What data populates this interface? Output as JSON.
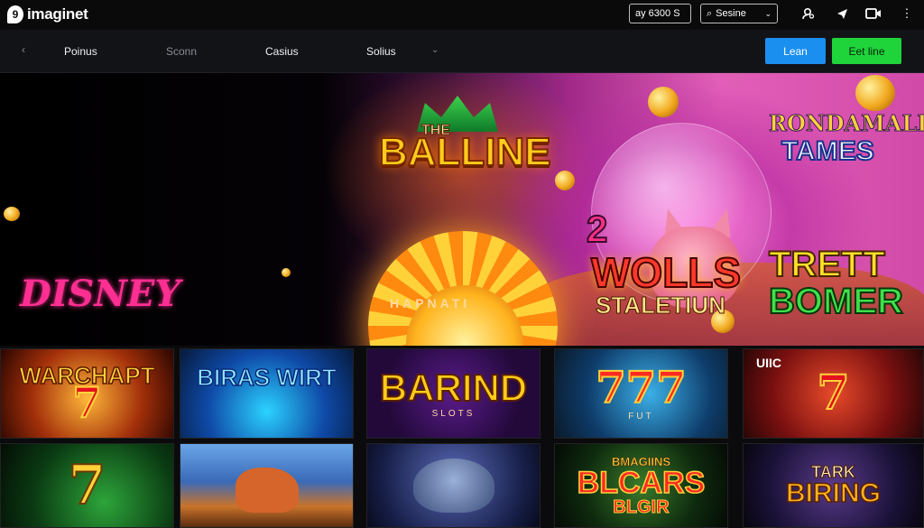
{
  "brand": {
    "name": "imaginet",
    "mark": "9"
  },
  "header": {
    "balance": "ay 6300 S",
    "session": "Sesine",
    "icons": [
      "user-search-icon",
      "send-icon",
      "video-icon",
      "more-icon"
    ]
  },
  "subnav": {
    "items": [
      {
        "label": "Poinus",
        "muted": false
      },
      {
        "label": "Sconn",
        "muted": true
      },
      {
        "label": "Casius",
        "muted": false
      },
      {
        "label": "Solius",
        "muted": false
      }
    ],
    "learn_button": "Lean",
    "bet_button": "Eet line"
  },
  "hero": {
    "the": "THE",
    "balline": "BALLINE",
    "rondamall": "RONDAMALL",
    "tames": "TAMES",
    "two": "2",
    "wolls": "WOLLS",
    "staletiun": "STALETIUN",
    "trett": "TRETT",
    "bomer": "BOMER",
    "disney": "DISNEY",
    "arch": "HAPNATI"
  },
  "tiles_row1": [
    {
      "title": "WARCHAPT",
      "seven": "7"
    },
    {
      "title": "BIRAS WIRT"
    },
    {
      "title": "BARIND",
      "sub": "SLOTS"
    },
    {
      "title": "777",
      "sub": "FUT"
    },
    {
      "title": "UIIC",
      "seven": "7"
    }
  ],
  "tiles_row2": [
    {
      "seven": "7"
    },
    {
      "title": ""
    },
    {
      "title": ""
    },
    {
      "title": "BMAGIINS",
      "big": "BLCARS",
      "sub": "BLGIR"
    },
    {
      "title": "TARK",
      "big": "BIRING"
    }
  ],
  "colors": {
    "learn": "#1a8ff0",
    "bet": "#1fd33a",
    "accent_pink": "#ff2f92",
    "gold": "#ffcc1a"
  }
}
